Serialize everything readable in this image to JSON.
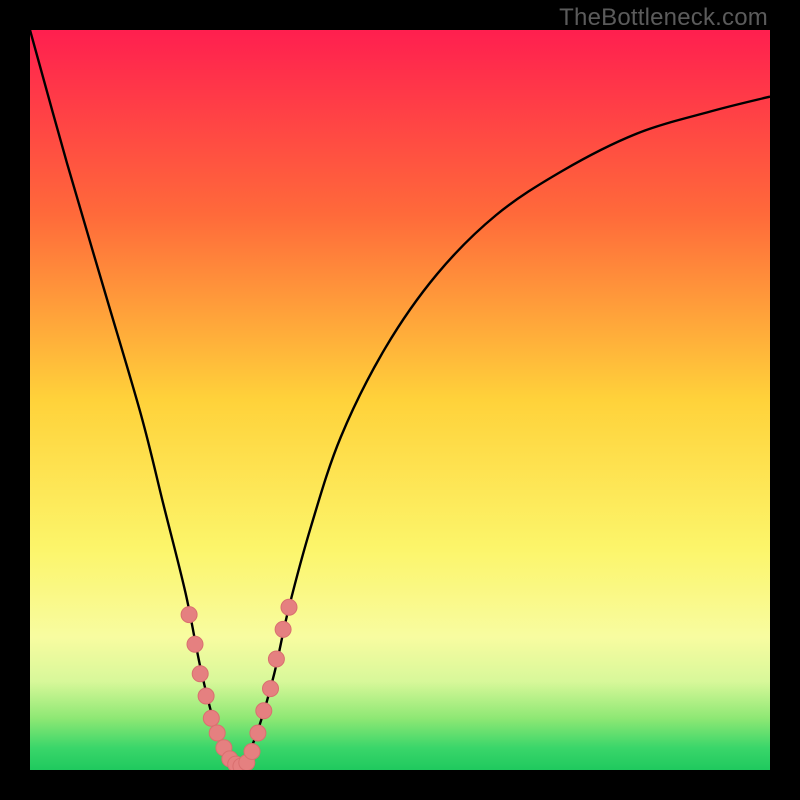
{
  "watermark": {
    "text": "TheBottleneck.com"
  },
  "colors": {
    "frame": "#000000",
    "watermark": "#5b5b5b",
    "curve": "#000000",
    "marker_fill": "#e58080",
    "marker_stroke": "#d96f6f"
  },
  "chart_data": {
    "type": "line",
    "title": "",
    "xlabel": "",
    "ylabel": "",
    "xlim": [
      0,
      100
    ],
    "ylim": [
      0,
      100
    ],
    "gradient_stops": [
      {
        "pct": 0,
        "color": "#ff1f4f"
      },
      {
        "pct": 25,
        "color": "#ff6a3a"
      },
      {
        "pct": 50,
        "color": "#ffd23a"
      },
      {
        "pct": 70,
        "color": "#fcf56a"
      },
      {
        "pct": 82,
        "color": "#f8fca0"
      },
      {
        "pct": 88,
        "color": "#d8f89a"
      },
      {
        "pct": 93,
        "color": "#8ee874"
      },
      {
        "pct": 97,
        "color": "#3ad66a"
      },
      {
        "pct": 100,
        "color": "#1fc95e"
      }
    ],
    "series": [
      {
        "name": "bottleneck-curve",
        "x": [
          0,
          5,
          10,
          15,
          18,
          21,
          23,
          25,
          27,
          28,
          29,
          31,
          33,
          35,
          38,
          42,
          48,
          55,
          63,
          72,
          82,
          92,
          100
        ],
        "y": [
          100,
          82,
          65,
          48,
          36,
          24,
          14,
          6,
          1,
          0,
          1,
          6,
          13,
          22,
          33,
          45,
          57,
          67,
          75,
          81,
          86,
          89,
          91
        ]
      }
    ],
    "markers": [
      {
        "x": 21.5,
        "y": 21
      },
      {
        "x": 22.3,
        "y": 17
      },
      {
        "x": 23.0,
        "y": 13
      },
      {
        "x": 23.8,
        "y": 10
      },
      {
        "x": 24.5,
        "y": 7
      },
      {
        "x": 25.3,
        "y": 5
      },
      {
        "x": 26.2,
        "y": 3
      },
      {
        "x": 27.0,
        "y": 1.5
      },
      {
        "x": 27.8,
        "y": 0.8
      },
      {
        "x": 28.5,
        "y": 0.5
      },
      {
        "x": 29.3,
        "y": 1.0
      },
      {
        "x": 30.0,
        "y": 2.5
      },
      {
        "x": 30.8,
        "y": 5
      },
      {
        "x": 31.6,
        "y": 8
      },
      {
        "x": 32.5,
        "y": 11
      },
      {
        "x": 33.3,
        "y": 15
      },
      {
        "x": 34.2,
        "y": 19
      },
      {
        "x": 35.0,
        "y": 22
      }
    ]
  }
}
